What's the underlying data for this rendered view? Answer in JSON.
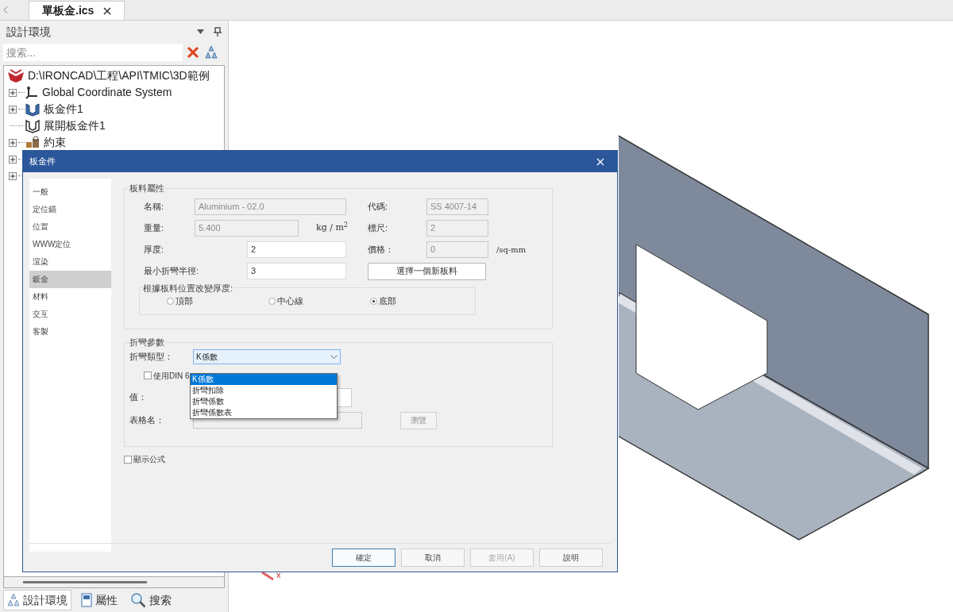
{
  "document_tab": {
    "label": "單板金.ics",
    "selected": true
  },
  "panel": {
    "title": "設計環境",
    "search": {
      "placeholder": "搜索..."
    }
  },
  "tree": {
    "root": "D:\\IRONCAD\\工程\\API\\TMIC\\3D範例",
    "children": [
      {
        "label": "Global Coordinate System",
        "kind": "axes",
        "expandable": true
      },
      {
        "label": "板金件1",
        "kind": "sheet",
        "expandable": true
      },
      {
        "label": "展開板金件1",
        "kind": "unfold",
        "expandable": false
      },
      {
        "label": "約束",
        "kind": "constraint",
        "expandable": true
      },
      {
        "kind": "hidden",
        "expandable": true
      },
      {
        "kind": "hidden",
        "expandable": true
      }
    ]
  },
  "bottom_tabs": [
    {
      "label": "設計環境",
      "kind": "scene",
      "selected": true
    },
    {
      "label": "屬性",
      "kind": "props",
      "selected": false
    },
    {
      "label": "搜索",
      "kind": "search",
      "selected": false
    }
  ],
  "viewport": {
    "axis_label": "x"
  },
  "dialog": {
    "title": "板金件",
    "nav": [
      {
        "label": "一般",
        "selected": false
      },
      {
        "label": "定位錨",
        "selected": false
      },
      {
        "label": "位置",
        "selected": false
      },
      {
        "label": "WWW定位",
        "selected": false
      },
      {
        "label": "渲染",
        "selected": false
      },
      {
        "label": "鈑金",
        "selected": true
      },
      {
        "label": "材料",
        "selected": false
      },
      {
        "label": "交互",
        "selected": false
      },
      {
        "label": "客製",
        "selected": false
      }
    ],
    "material": {
      "title": "板料屬性",
      "name": {
        "label": "名稱:",
        "value": "Aluminium - 02.0",
        "disabled": true
      },
      "weight": {
        "label": "重量:",
        "value": "5.400",
        "disabled": true,
        "unit": "kg / m$^{2}$"
      },
      "thickness": {
        "label": "厚度:",
        "value": "2",
        "disabled": false
      },
      "min_radius": {
        "label": "最小折彎半徑:",
        "value": "3",
        "disabled": false
      },
      "code": {
        "label": "代碼:",
        "value": "SS 4007-14",
        "disabled": true
      },
      "gauge": {
        "label": "標尺:",
        "value": "2",
        "disabled": true
      },
      "price": {
        "label": "價格：",
        "value": "0",
        "disabled": true,
        "unit": "/sq-mm"
      },
      "choose_button": "選擇一個新板料",
      "position": {
        "title": "根據板料位置改變厚度:",
        "options": [
          {
            "label": "頂部",
            "selected": false
          },
          {
            "label": "中心線",
            "selected": false
          },
          {
            "label": "底部",
            "selected": true
          }
        ]
      }
    },
    "bend": {
      "title": "折彎參數",
      "type_label": "折彎類型：",
      "type_value": "K係數",
      "expanded": true,
      "options": [
        {
          "label": "K係數",
          "selected": true
        },
        {
          "label": "折彎扣除",
          "selected": false
        },
        {
          "label": "折彎係數",
          "selected": false
        },
        {
          "label": "折彎係數表",
          "selected": false
        }
      ],
      "din": {
        "label": "使用DIN 6",
        "checked": false
      },
      "value_label": "值：",
      "table_label": "表格名：",
      "browse_button": {
        "label": "瀏覽",
        "disabled": true
      }
    },
    "show_formula": {
      "label": "顯示公式",
      "checked": false
    },
    "buttons": [
      {
        "label": "確定",
        "disabled": false,
        "default": true
      },
      {
        "label": "取消",
        "disabled": false,
        "default": false
      },
      {
        "label": "套用(A)",
        "disabled": true,
        "default": false
      },
      {
        "label": "說明",
        "disabled": false,
        "default": false
      }
    ]
  }
}
